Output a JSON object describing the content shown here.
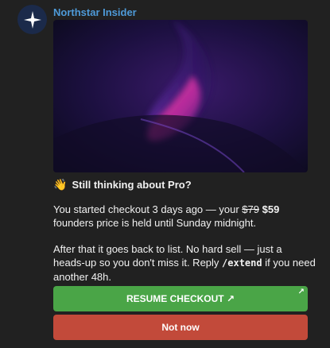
{
  "sender": "Northstar Insider",
  "message": {
    "title_emoji": "👋",
    "title": "Still thinking about Pro?",
    "p1_part1": "You started checkout 3 days ago — your ",
    "old_price": "$79",
    "new_price": "$59",
    "p1_part2": "founders price is held until Sunday midnight.",
    "p2_part1": "After that it goes back to list. No hard sell — just a heads-up so you don't miss it. Reply ",
    "command": "/extend",
    "p2_part2": " if you need another 48h."
  },
  "buttons": {
    "resume": "RESUME CHECKOUT ↗",
    "resume_corner": "↗",
    "not_now": "Not now"
  },
  "colors": {
    "background": "#212121",
    "sender": "#4e9ad8",
    "resume_button": "#4aa547",
    "not_now_button": "#c24a3a"
  }
}
